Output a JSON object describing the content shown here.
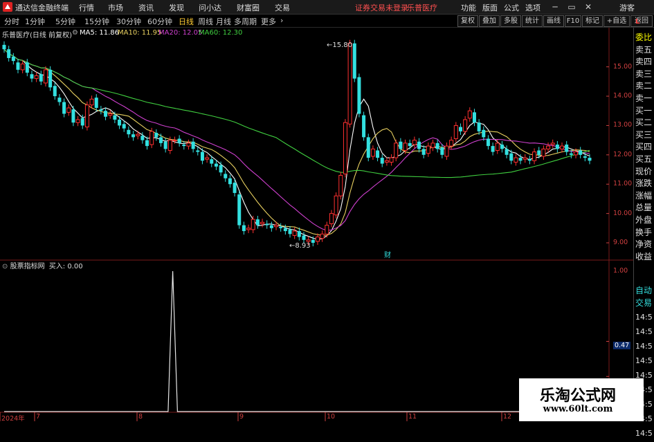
{
  "menubar": {
    "app_title": "通达信金融终端",
    "menus": [
      "行情",
      "市场",
      "资讯",
      "发现",
      "问小达",
      "财富圈",
      "交易"
    ],
    "status_notice": "证券交易未登录",
    "stock_name": "乐普医疗",
    "right_items": [
      "功能",
      "版面",
      "公式",
      "选项"
    ],
    "guest": "游客"
  },
  "periodbar": {
    "periods": [
      "分时",
      "1分钟",
      "5分钟",
      "15分钟",
      "30分钟",
      "60分钟",
      "日线",
      "周线",
      "月线",
      "多周期",
      "更多"
    ],
    "active": "日线",
    "right_buttons": [
      "复权",
      "叠加",
      "多股",
      "统计",
      "画线",
      "F10",
      "标记",
      "+自选",
      "返回"
    ]
  },
  "infoline": {
    "title": "乐普医疗(日线 前复权)",
    "ma5": "MA5: 11.86",
    "ma10": "MA10: 11.95",
    "ma20": "MA20: 12.05",
    "ma60": "MA60: 12.30"
  },
  "indicator": {
    "label": "股票指标网",
    "value": "买入: 0.00"
  },
  "rightpanel": {
    "top_tag": "L",
    "labels": [
      "委比",
      "卖五",
      "卖四",
      "卖三",
      "卖二",
      "卖一",
      "买一",
      "买二",
      "买三",
      "买四",
      "买五",
      "现价",
      "涨跌",
      "涨幅",
      "总量",
      "外盘",
      "换手",
      "净资",
      "收益"
    ],
    "bottom_labels": [
      "自动",
      "交易"
    ],
    "times": [
      "14:5",
      "14:5",
      "14:5",
      "14:5",
      "14:5",
      "14:5",
      "14:5",
      "14:5",
      "14:5"
    ]
  },
  "markers": {
    "high_label": "15.80",
    "low_label": "8.93",
    "fin_marker": "财"
  },
  "watermark": {
    "line1": "乐淘公式网",
    "line2": "www.60lt.com"
  },
  "colors": {
    "up": "#ff3030",
    "down": "#33e0e0",
    "ma5": "#ffffff",
    "ma10": "#e8d060",
    "ma20": "#d040d0",
    "ma60": "#40d040",
    "axis": "#d04040"
  },
  "chart_data": [
    {
      "type": "candlestick",
      "title": "乐普医疗(日线 前复权)",
      "yticks": [
        9.0,
        10.0,
        11.0,
        12.0,
        13.0,
        14.0,
        15.0
      ],
      "ylim": [
        8.6,
        16.1
      ],
      "xticks": [
        "2024年",
        "7",
        "8",
        "9",
        "10",
        "11",
        "12"
      ],
      "series": [
        {
          "name": "MA5",
          "value": 11.86
        },
        {
          "name": "MA10",
          "value": 11.95
        },
        {
          "name": "MA20",
          "value": 12.05
        },
        {
          "name": "MA60",
          "value": 12.3
        }
      ],
      "close": [
        15.6,
        15.3,
        15.2,
        14.9,
        15.1,
        14.8,
        14.6,
        14.7,
        14.5,
        14.9,
        14.3,
        14.0,
        13.8,
        13.4,
        13.6,
        13.1,
        13.2,
        13.0,
        13.7,
        13.9,
        13.6,
        13.5,
        13.3,
        13.4,
        13.2,
        13.0,
        12.9,
        12.7,
        12.6,
        12.7,
        12.5,
        12.3,
        12.8,
        12.6,
        12.4,
        12.2,
        12.5,
        12.5,
        12.4,
        12.3,
        12.4,
        12.2,
        12.1,
        11.8,
        11.9,
        11.7,
        11.6,
        11.4,
        11.2,
        11.0,
        10.7,
        9.6,
        9.4,
        9.5,
        9.8,
        9.6,
        9.7,
        9.6,
        9.5,
        9.6,
        9.5,
        9.4,
        9.3,
        9.4,
        9.2,
        9.1,
        9.1,
        9.0,
        9.2,
        9.3,
        9.6,
        10.0,
        10.6,
        11.3,
        13.1,
        15.8,
        14.6,
        13.4,
        12.6,
        11.9,
        12.2,
        11.9,
        11.7,
        11.8,
        11.9,
        12.4,
        12.2,
        12.4,
        12.3,
        12.5,
        12.2,
        12.0,
        12.3,
        12.4,
        12.2,
        12.0,
        12.3,
        12.5,
        13.0,
        12.8,
        13.2,
        13.5,
        13.1,
        12.8,
        12.6,
        12.3,
        12.1,
        12.4,
        12.2,
        12.0,
        11.8,
        11.9,
        11.8,
        11.9,
        11.8,
        12.1,
        12.0,
        12.2,
        12.3,
        12.4,
        12.2,
        12.3,
        12.1,
        12.0,
        12.1,
        12.0,
        11.9,
        11.8
      ],
      "annotations": [
        {
          "label": "15.80",
          "value": 15.8
        },
        {
          "label": "8.93",
          "value": 8.93
        }
      ]
    },
    {
      "type": "line",
      "title": "股票指标网",
      "series_name": "买入",
      "yticks": [
        1.0,
        0.47
      ],
      "ylim": [
        0,
        1.0
      ],
      "signal_index": 36,
      "count": 126
    }
  ]
}
